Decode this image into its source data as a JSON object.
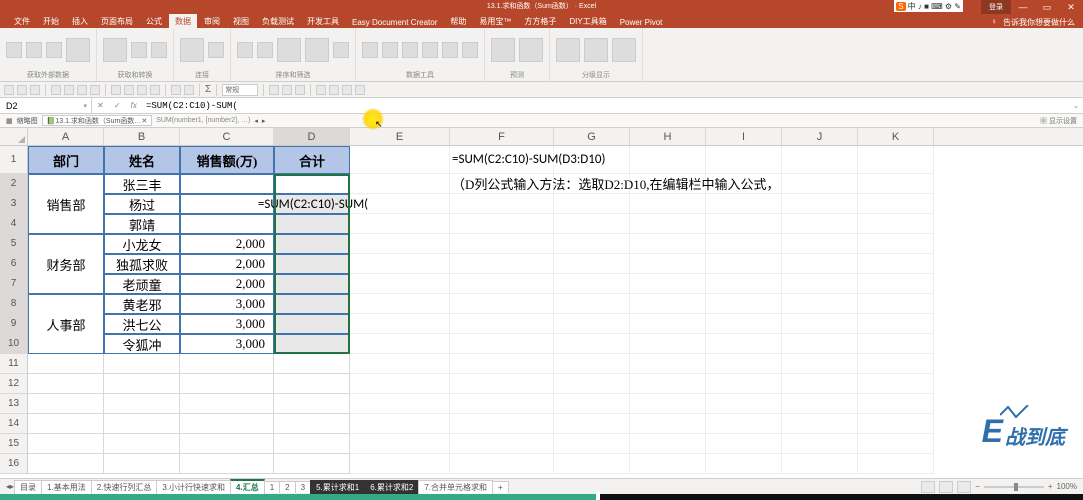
{
  "title_bar": {
    "title": "13.1.求和函数（Sum函数） · Excel",
    "login": "登录",
    "min": "—",
    "restore": "▭",
    "close": "✕",
    "ime_badge": "S",
    "ime_text": "中 ♪ ■ ⌨ ⚙ ✎"
  },
  "menu": {
    "tabs": [
      "文件",
      "开始",
      "插入",
      "页面布局",
      "公式",
      "数据",
      "审阅",
      "视图",
      "负载测试",
      "开发工具",
      "Easy Document Creator",
      "帮助",
      "易用宝™",
      "方方格子",
      "DIY工具箱",
      "Power Pivot"
    ],
    "active_index": 5,
    "tell_me": "告诉我你想要做什么"
  },
  "ribbon_groups": [
    "获取外部数据",
    "获取和转换",
    "连接",
    "排序和筛选",
    "数据工具",
    "预测",
    "分级显示"
  ],
  "qat": {
    "combo_value": "常规"
  },
  "formula_bar": {
    "name_box": "D2",
    "cancel": "✕",
    "enter": "✓",
    "fx": "fx",
    "formula": "=SUM(C2:C10)-SUM("
  },
  "workbook_tabs": {
    "breadcrumb": "缩略图",
    "doc1": "13.1.求和函数（Sum函数…",
    "hint": "SUM(number1, [number2], …)",
    "scroll_left": "◂",
    "scroll_right": "▸",
    "right_hint": "显示设置"
  },
  "grid": {
    "columns": [
      "A",
      "B",
      "C",
      "D",
      "E",
      "F",
      "G",
      "H",
      "I",
      "J",
      "K"
    ],
    "header_row": {
      "A": "部门",
      "B": "姓名",
      "C": "销售额(万)",
      "D": "合计"
    },
    "rows": [
      {
        "n": 2,
        "B": "张三丰",
        "C": "",
        "D": ""
      },
      {
        "n": 3,
        "B": "杨过",
        "C": "",
        "D": "=SUM(C2:C10)-SUM("
      },
      {
        "n": 4,
        "B": "郭靖",
        "C": "",
        "D": ""
      },
      {
        "n": 5,
        "B": "小龙女",
        "C": "2,000",
        "D": ""
      },
      {
        "n": 6,
        "B": "独孤求败",
        "C": "2,000",
        "D": ""
      },
      {
        "n": 7,
        "B": "老顽童",
        "C": "2,000",
        "D": ""
      },
      {
        "n": 8,
        "B": "黄老邪",
        "C": "3,000",
        "D": ""
      },
      {
        "n": 9,
        "B": "洪七公",
        "C": "3,000",
        "D": ""
      },
      {
        "n": 10,
        "B": "令狐冲",
        "C": "3,000",
        "D": ""
      }
    ],
    "dept_merge": [
      {
        "start": 2,
        "span": 3,
        "text": "销售部"
      },
      {
        "start": 5,
        "span": 3,
        "text": "财务部"
      },
      {
        "start": 8,
        "span": 3,
        "text": "人事部"
      }
    ],
    "side_text": {
      "row2": "=SUM(C2:C10)-SUM(D3:D10)",
      "row3": "（D列公式输入方法：选取D2:D10,在编辑栏中输入公式，"
    },
    "empty_rows": [
      11,
      12,
      13,
      14,
      15,
      16
    ]
  },
  "watermark": {
    "e": "E",
    "text": "战到底"
  },
  "sheet_tabs": {
    "nav_first": "◂",
    "nav_last": "▸",
    "tabs": [
      "目录",
      "1.基本用法",
      "2.快速行列汇总",
      "3.小计行快速求和",
      "4.汇总",
      "1",
      "2",
      "3",
      "5.累计求和1",
      "6.累计求和2",
      "7.合并单元格求和"
    ],
    "active_index": 4,
    "add": "+"
  },
  "status": {
    "zoom_minus": "−",
    "zoom_plus": "+",
    "zoom_pct": "100%"
  }
}
